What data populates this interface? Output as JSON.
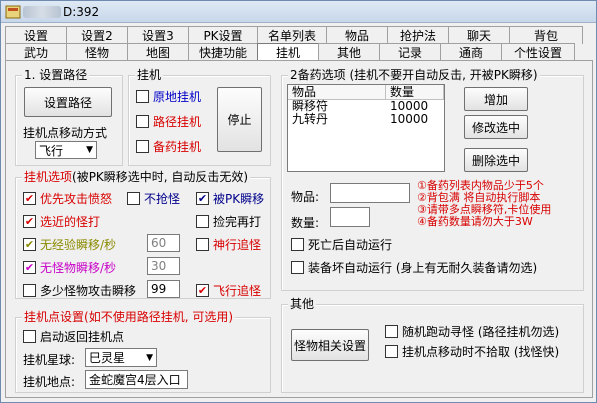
{
  "title": {
    "text": "D:392"
  },
  "tabs_row1": [
    "设置",
    "设置2",
    "设置3",
    "PK设置",
    "名单列表",
    "物品",
    "抢护法",
    "聊天",
    "背包"
  ],
  "tabs_row2": [
    "武功",
    "怪物",
    "地图",
    "快捷功能",
    "挂机",
    "其他",
    "记录",
    "通商",
    "个性设置"
  ],
  "active_tab": "挂机",
  "path_group": {
    "label": "1. 设置路径",
    "button": "设置路径",
    "move_label": "挂机点移动方式",
    "move_value": "飞行"
  },
  "hang_group": {
    "label": "挂机",
    "items": [
      {
        "label": "原地挂机",
        "checked": false,
        "color": "#0000c8"
      },
      {
        "label": "路径挂机",
        "checked": false,
        "color": "#d80000"
      },
      {
        "label": "备药挂机",
        "checked": false,
        "color": "#d80000"
      }
    ],
    "stop_button": "停止"
  },
  "options_group": {
    "label": "挂机选项",
    "note": "(被PK瞬移选中时, 自动反击无效)",
    "priority_attack": {
      "label": "优先攻击愤怒",
      "checked": true
    },
    "no_grab": {
      "label": "不抢怪",
      "checked": false
    },
    "pk_teleport": {
      "label": "被PK瞬移",
      "checked": true
    },
    "pick_after": {
      "label": "捡完再打",
      "checked": false
    },
    "selected_monster": {
      "label": "选近的怪打",
      "checked": true
    },
    "no_exp_teleport": {
      "label": "无经验瞬移/秒",
      "checked": true,
      "value": "60"
    },
    "god_chase": {
      "label": "神行追怪",
      "checked": false
    },
    "no_monster_teleport": {
      "label": "无怪物瞬移/秒",
      "checked": true,
      "value": "30"
    },
    "fly_chase": {
      "label": "飞行追怪",
      "checked": true
    },
    "multi_monster": {
      "label": "多少怪物攻击瞬移",
      "checked": false,
      "value": "99"
    }
  },
  "hang_point_group": {
    "label": "挂机点设置",
    "note": "(如不使用路径挂机, 可选用)",
    "auto_return": {
      "label": "启动返回挂机点",
      "checked": false
    },
    "planet_label": "挂机星球:",
    "planet_value": "巳灵星",
    "location_label": "挂机地点:",
    "location_value": "金蛇魔宫4层入口"
  },
  "supply_group": {
    "label": "2备药选项 (挂机不要开自动反击, 开被PK瞬移)",
    "columns": [
      "物品",
      "数量"
    ],
    "rows": [
      {
        "item": "瞬移符",
        "qty": "10000"
      },
      {
        "item": "九转丹",
        "qty": "10000"
      }
    ],
    "add_button": "增加",
    "edit_button": "修改选中",
    "delete_button": "删除选中",
    "item_label": "物品:",
    "item_value": "",
    "qty_label": "数量:",
    "qty_value": "",
    "notes": [
      "①备药列表内物品少于5个",
      "②背包满 将自动执行脚本",
      "③请带多点瞬移符,卡位使用",
      "④备药数量请勿大于3W"
    ],
    "death_auto": {
      "label": "死亡后自动运行",
      "checked": false
    },
    "durability_auto": {
      "label": "装备坏自动运行 (身上有无耐久装备请勿选)",
      "checked": false
    }
  },
  "other_group": {
    "label": "其他",
    "monster_button": "怪物相关设置",
    "random_run": {
      "label": "随机跑动寻怪 (路径挂机勿选)",
      "checked": false
    },
    "no_pick_move": {
      "label": "挂机点移动时不拾取 (找怪快)",
      "checked": false
    }
  },
  "colors": {
    "accent_red": "#d80000",
    "accent_blue": "#0000c8"
  }
}
